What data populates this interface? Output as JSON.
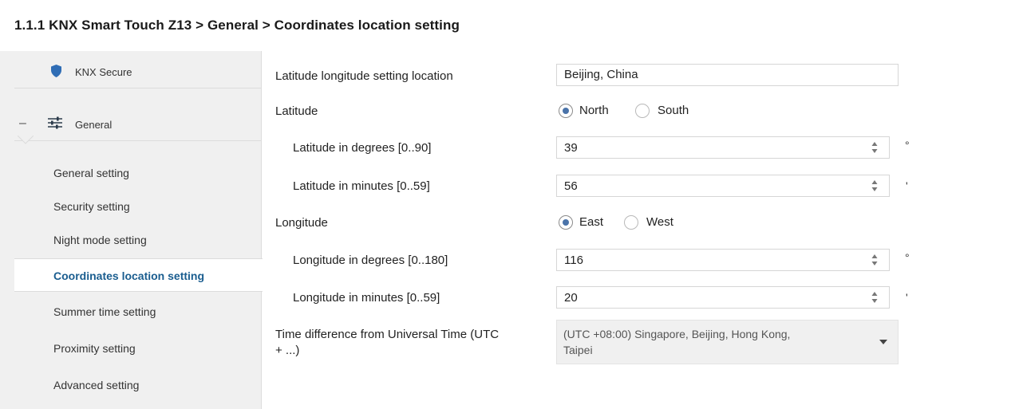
{
  "breadcrumb": "1.1.1 KNX Smart Touch Z13 > General > Coordinates location setting",
  "sidebar": {
    "secure_label": "KNX Secure",
    "general_label": "General",
    "collapse_glyph": "–",
    "items": [
      {
        "label": "General setting"
      },
      {
        "label": "Security setting"
      },
      {
        "label": "Night mode setting"
      },
      {
        "label": "Coordinates location setting"
      },
      {
        "label": "Summer time setting"
      },
      {
        "label": "Proximity setting"
      },
      {
        "label": "Advanced setting"
      }
    ],
    "active_index": 3
  },
  "form": {
    "location": {
      "label": "Latitude longitude setting location",
      "value": "Beijing, China"
    },
    "latitude": {
      "label": "Latitude",
      "options": [
        "North",
        "South"
      ],
      "selected": "North"
    },
    "lat_degrees": {
      "label": "Latitude in degrees [0..90]",
      "value": "39",
      "unit": "°"
    },
    "lat_minutes": {
      "label": "Latitude in minutes [0..59]",
      "value": "56",
      "unit": "'"
    },
    "longitude": {
      "label": "Longitude",
      "options": [
        "East",
        "West"
      ],
      "selected": "East"
    },
    "lon_degrees": {
      "label": "Longitude in degrees [0..180]",
      "value": "116",
      "unit": "°"
    },
    "lon_minutes": {
      "label": "Longitude in minutes [0..59]",
      "value": "20",
      "unit": "'"
    },
    "timezone": {
      "label_line1": "Time difference from Universal Time (UTC",
      "label_line2": "+ ...)",
      "value_line1": "(UTC +08:00) Singapore,  Beijing, Hong Kong,",
      "value_line2": "Taipei"
    }
  },
  "colors": {
    "accent": "#1a5d8f",
    "shield": "#2f6db5",
    "radio_dot": "#4a73a9",
    "sidebar_bg": "#f0f0f0"
  },
  "icons": {
    "secure": "shield-icon",
    "general": "sliders-icon",
    "spinner": "spinner-arrows-icon",
    "dropdown": "chevron-down-icon"
  }
}
